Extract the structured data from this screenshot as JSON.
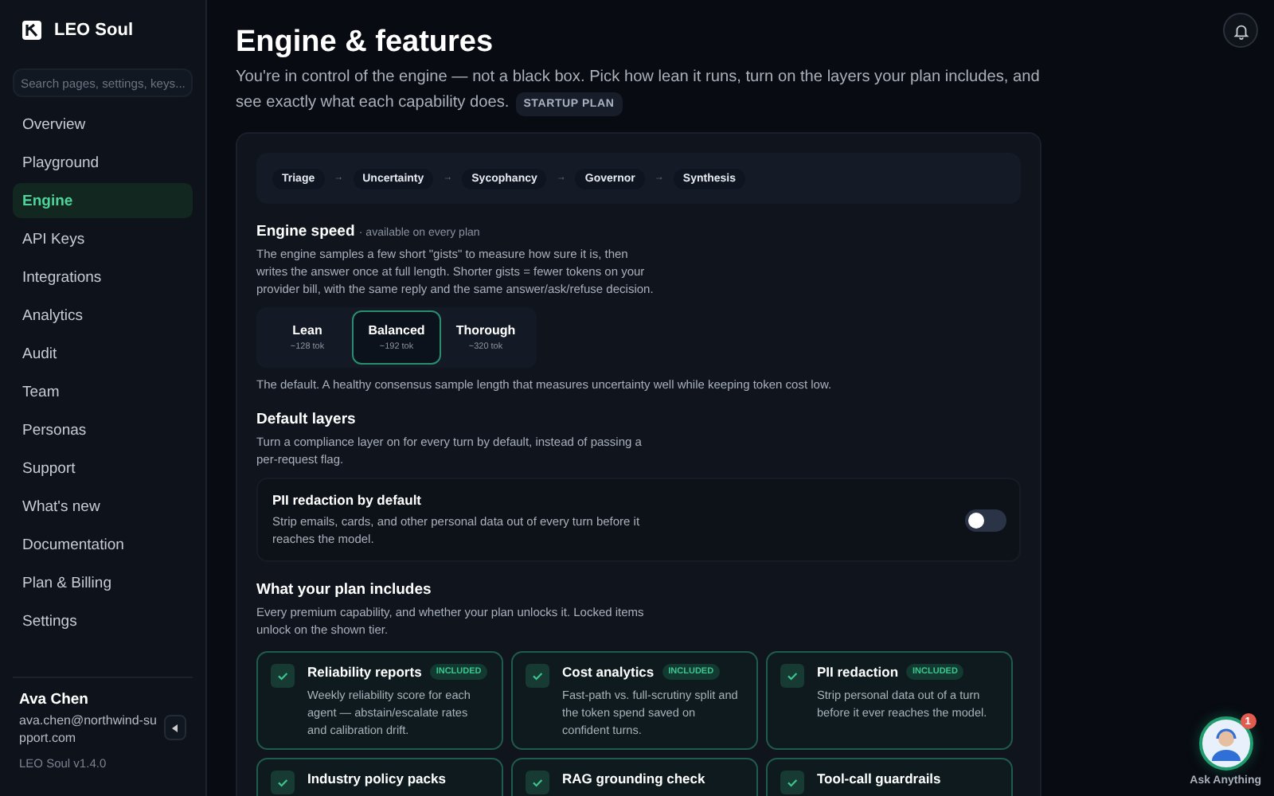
{
  "sidebar": {
    "brand": "LEO Soul",
    "search": {
      "placeholder": "Search pages, settings, keys..."
    },
    "items": [
      {
        "label": "Overview",
        "selected": false
      },
      {
        "label": "Playground",
        "selected": false
      },
      {
        "label": "Engine",
        "selected": true
      },
      {
        "label": "API Keys",
        "selected": false
      },
      {
        "label": "Integrations",
        "selected": false
      },
      {
        "label": "Analytics",
        "selected": false
      },
      {
        "label": "Audit",
        "selected": false
      },
      {
        "label": "Team",
        "selected": false
      },
      {
        "label": "Personas",
        "selected": false
      },
      {
        "label": "Support",
        "selected": false
      },
      {
        "label": "What's new",
        "selected": false
      },
      {
        "label": "Documentation",
        "selected": false
      },
      {
        "label": "Plan & Billing",
        "selected": false
      },
      {
        "label": "Settings",
        "selected": false
      }
    ],
    "user": {
      "name": "Ava Chen",
      "email": "ava.chen@northwind-support.com"
    },
    "version": "LEO Soul v1.4.0"
  },
  "page": {
    "title": "Engine & features",
    "intro": "You're in control of the engine — not a black box. Pick how lean it runs, turn on the layers your plan includes, and see exactly what each capability does.",
    "plan_badge": "STARTUP PLAN"
  },
  "pipeline": {
    "steps": [
      "Triage",
      "Uncertainty",
      "Sycophancy",
      "Governor",
      "Synthesis"
    ],
    "separator": "→"
  },
  "engine_speed": {
    "title": "Engine speed",
    "note": "· available on every plan",
    "description": "The engine samples a few short \"gists\" to measure how sure it is, then writes the answer once at full length. Shorter gists = fewer tokens on your provider bill, with the same reply and the same answer/ask/refuse decision.",
    "options": [
      {
        "label": "Lean",
        "tokens": "~128 tok",
        "selected": false
      },
      {
        "label": "Balanced",
        "tokens": "~192 tok",
        "selected": true
      },
      {
        "label": "Thorough",
        "tokens": "~320 tok",
        "selected": false
      }
    ],
    "selected_description": "The default. A healthy consensus sample length that measures uncertainty well while keeping token cost low."
  },
  "default_layers": {
    "title": "Default layers",
    "description": "Turn a compliance layer on for every turn by default, instead of passing a per-request flag.",
    "layers": [
      {
        "title": "PII redaction by default",
        "description": "Strip emails, cards, and other personal data out of every turn before it reaches the model.",
        "on": false
      }
    ]
  },
  "plan_includes": {
    "title": "What your plan includes",
    "description": "Every premium capability, and whether your plan unlocks it. Locked items unlock on the shown tier.",
    "features": [
      {
        "title": "Reliability reports",
        "badge": "INCLUDED",
        "description": "Weekly reliability score for each agent — abstain/escalate rates and calibration drift.",
        "included": true
      },
      {
        "title": "Cost analytics",
        "badge": "INCLUDED",
        "description": "Fast-path vs. full-scrutiny split and the token spend saved on confident turns.",
        "included": true
      },
      {
        "title": "PII redaction",
        "badge": "INCLUDED",
        "description": "Strip personal data out of a turn before it ever reaches the model.",
        "included": true
      },
      {
        "title": "Industry policy packs",
        "included": true
      },
      {
        "title": "RAG grounding check",
        "included": true
      },
      {
        "title": "Tool-call guardrails",
        "included": true
      }
    ]
  },
  "assistant": {
    "label": "Ask Anything",
    "badge": "1"
  }
}
